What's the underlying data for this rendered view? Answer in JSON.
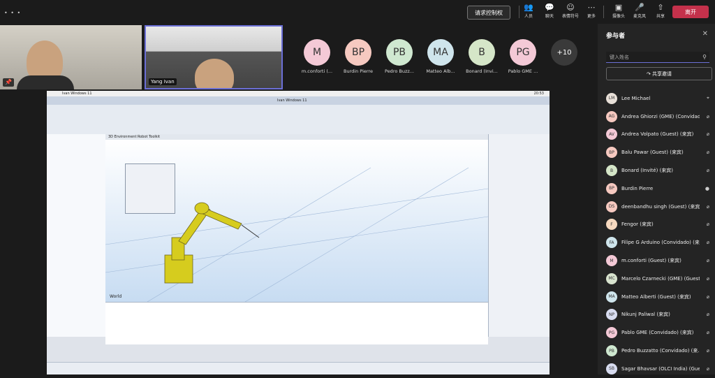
{
  "topbar": {
    "dots": "• • •",
    "request_control": "请求控制权",
    "items": [
      {
        "label": "人员",
        "icon": "people-icon"
      },
      {
        "label": "聊天",
        "icon": "chat-icon"
      },
      {
        "label": "表情符号",
        "icon": "emoji-icon"
      },
      {
        "label": "更多",
        "icon": "more-icon"
      },
      {
        "label": "摄像头",
        "icon": "camera-icon"
      },
      {
        "label": "麦克风",
        "icon": "mic-off-icon"
      },
      {
        "label": "共享",
        "icon": "share-icon"
      }
    ],
    "leave": "离开"
  },
  "videos": {
    "tile2_name": "Yang Ivan"
  },
  "avatars": [
    {
      "initials": "M",
      "name": "m.conforti (...",
      "color": "#f4c9d6"
    },
    {
      "initials": "BP",
      "name": "Burdin Pierre",
      "color": "#f6c9c0"
    },
    {
      "initials": "PB",
      "name": "Pedro Buzz...",
      "color": "#cfe8d0"
    },
    {
      "initials": "MA",
      "name": "Matteo Alb...",
      "color": "#cfe5ec"
    },
    {
      "initials": "B",
      "name": "Bonard (Invi...",
      "color": "#d5e6c8"
    },
    {
      "initials": "PG",
      "name": "Pablo GME ...",
      "color": "#f4c9d6"
    }
  ],
  "overflow": "+10",
  "shared": {
    "app_title": "Ivan Windows 11",
    "inner_title": "Ivan Windows 11",
    "tab1": "3D Environment",
    "tab2": "Robot Toolkit",
    "world": "World",
    "clock": "20:53"
  },
  "panel": {
    "title": "参与者",
    "search_placeholder": "键入姓名",
    "invite": "共享邀请",
    "participants": [
      {
        "initials": "LM",
        "name": "Lee Michael",
        "color": "#e8e0d8",
        "status": "pin"
      },
      {
        "initials": "AG",
        "name": "Andrea Ghiorzi (GME) (Convidad...",
        "color": "#f6c9c0",
        "status": "mic-off"
      },
      {
        "initials": "AV",
        "name": "Andrea Volpato (Guest) (来宾)",
        "color": "#f4c9d6",
        "status": "mic-off"
      },
      {
        "initials": "BP",
        "name": "Balu Pawar (Guest) (来宾)",
        "color": "#f6c9c0",
        "status": "mic-off"
      },
      {
        "initials": "B",
        "name": "Bonard (Invité) (来宾)",
        "color": "#d5e6c8",
        "status": "mic-off"
      },
      {
        "initials": "BP",
        "name": "Burdin Pierre",
        "color": "#f6c9c0",
        "status": "mic-on"
      },
      {
        "initials": "DS",
        "name": "deenbandhu singh (Guest) (来宾)",
        "color": "#f6c9c0",
        "status": "mic-off"
      },
      {
        "initials": "F",
        "name": "Fengor (来宾)",
        "color": "#f6d9bf",
        "status": "mic-off"
      },
      {
        "initials": "FA",
        "name": "Filipe G Arduino (Convidado) (来...",
        "color": "#cfe5ec",
        "status": "mic-off"
      },
      {
        "initials": "M",
        "name": "m.conforti (Guest) (来宾)",
        "color": "#f4c9d6",
        "status": "mic-off"
      },
      {
        "initials": "MC",
        "name": "Marcelo Czarnecki (GME) (Guest...",
        "color": "#d9e4cf",
        "status": "mic-off"
      },
      {
        "initials": "MA",
        "name": "Matteo Alberti (Guest) (来宾)",
        "color": "#cfe5ec",
        "status": "mic-off"
      },
      {
        "initials": "NP",
        "name": "Nikunj Paliwal (来宾)",
        "color": "#d8dcf0",
        "status": "mic-off"
      },
      {
        "initials": "PG",
        "name": "Pablo GME (Convidado) (来宾)",
        "color": "#f4c9d6",
        "status": "mic-off"
      },
      {
        "initials": "PB",
        "name": "Pedro Buzzatto (Convidado) (来...",
        "color": "#cfe8d0",
        "status": "mic-off"
      },
      {
        "initials": "SB",
        "name": "Sagar Bhavsar (OLCI India) (Gue...",
        "color": "#d8dcf0",
        "status": "mic-off"
      }
    ]
  }
}
